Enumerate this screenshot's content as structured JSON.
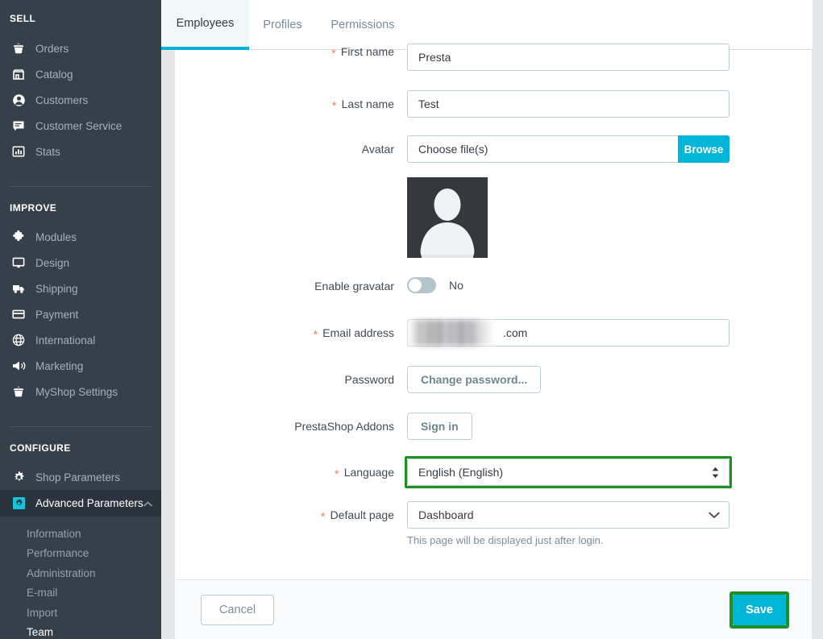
{
  "sidebar": {
    "sections": [
      {
        "heading": "SELL",
        "items": [
          {
            "label": "Orders",
            "icon": "basket-icon"
          },
          {
            "label": "Catalog",
            "icon": "store-icon"
          },
          {
            "label": "Customers",
            "icon": "person-circle-icon"
          },
          {
            "label": "Customer Service",
            "icon": "chat-icon"
          },
          {
            "label": "Stats",
            "icon": "bar-chart-icon"
          }
        ]
      },
      {
        "heading": "IMPROVE",
        "items": [
          {
            "label": "Modules",
            "icon": "puzzle-icon"
          },
          {
            "label": "Design",
            "icon": "monitor-icon"
          },
          {
            "label": "Shipping",
            "icon": "truck-icon"
          },
          {
            "label": "Payment",
            "icon": "credit-card-icon"
          },
          {
            "label": "International",
            "icon": "globe-icon"
          },
          {
            "label": "Marketing",
            "icon": "megaphone-icon"
          },
          {
            "label": "MyShop Settings",
            "icon": "basket-icon"
          }
        ]
      },
      {
        "heading": "CONFIGURE",
        "items": [
          {
            "label": "Shop Parameters",
            "icon": "gear-icon"
          },
          {
            "label": "Advanced Parameters",
            "icon": "gear-cyan-icon",
            "active": true,
            "expanded": true
          }
        ],
        "subitems": [
          {
            "label": "Information"
          },
          {
            "label": "Performance"
          },
          {
            "label": "Administration"
          },
          {
            "label": "E-mail"
          },
          {
            "label": "Import"
          },
          {
            "label": "Team",
            "current": true
          }
        ]
      }
    ]
  },
  "tabs": [
    {
      "label": "Employees",
      "active": true
    },
    {
      "label": "Profiles",
      "active": false
    },
    {
      "label": "Permissions",
      "active": false
    }
  ],
  "form": {
    "first_name": {
      "label": "First name",
      "required": true,
      "value": "Presta"
    },
    "last_name": {
      "label": "Last name",
      "required": true,
      "value": "Test"
    },
    "avatar": {
      "label": "Avatar",
      "required": false,
      "placeholder": "Choose file(s)",
      "browse_label": "Browse",
      "preview_icon": "user-silhouette-icon"
    },
    "gravatar": {
      "label": "Enable gravatar",
      "required": false,
      "state_label": "No",
      "enabled": false
    },
    "email": {
      "label": "Email address",
      "required": true,
      "value": ".com",
      "redacted": true
    },
    "password": {
      "label": "Password",
      "required": false,
      "button_label": "Change password..."
    },
    "addons": {
      "label": "PrestaShop Addons",
      "required": false,
      "button_label": "Sign in"
    },
    "language": {
      "label": "Language",
      "required": true,
      "value": "English (English)",
      "highlighted": true,
      "icon": "sort-updown-icon"
    },
    "default_page": {
      "label": "Default page",
      "required": true,
      "value": "Dashboard",
      "help": "This page will be displayed just after login.",
      "icon": "chevron-down-icon"
    }
  },
  "footer": {
    "cancel_label": "Cancel",
    "save_label": "Save",
    "save_highlighted": true
  },
  "colors": {
    "accent_cyan": "#00b5d6",
    "sidebar_bg": "#36404a",
    "annotation_green": "#1f8f24",
    "required_star": "#f1836c"
  }
}
